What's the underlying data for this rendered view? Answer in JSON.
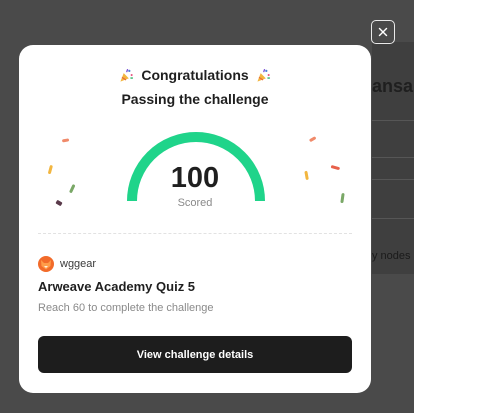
{
  "background_page": {
    "partial_title": "ansa",
    "partial_text": "y nodes"
  },
  "close_button": {
    "icon": "close-icon"
  },
  "modal": {
    "title": "Congratulations",
    "title_icon": "party-popper-icon",
    "subtitle": "Passing the challenge",
    "score": "100",
    "score_label": "Scored",
    "score_fraction": 1.0,
    "gauge_color": "#1fd48a",
    "organization": {
      "name": "wggear",
      "logo": "fox-logo-icon"
    },
    "quiz_title": "Arweave Academy Quiz 5",
    "quiz_description": "Reach 60 to complete the challenge",
    "cta_label": "View challenge details"
  }
}
